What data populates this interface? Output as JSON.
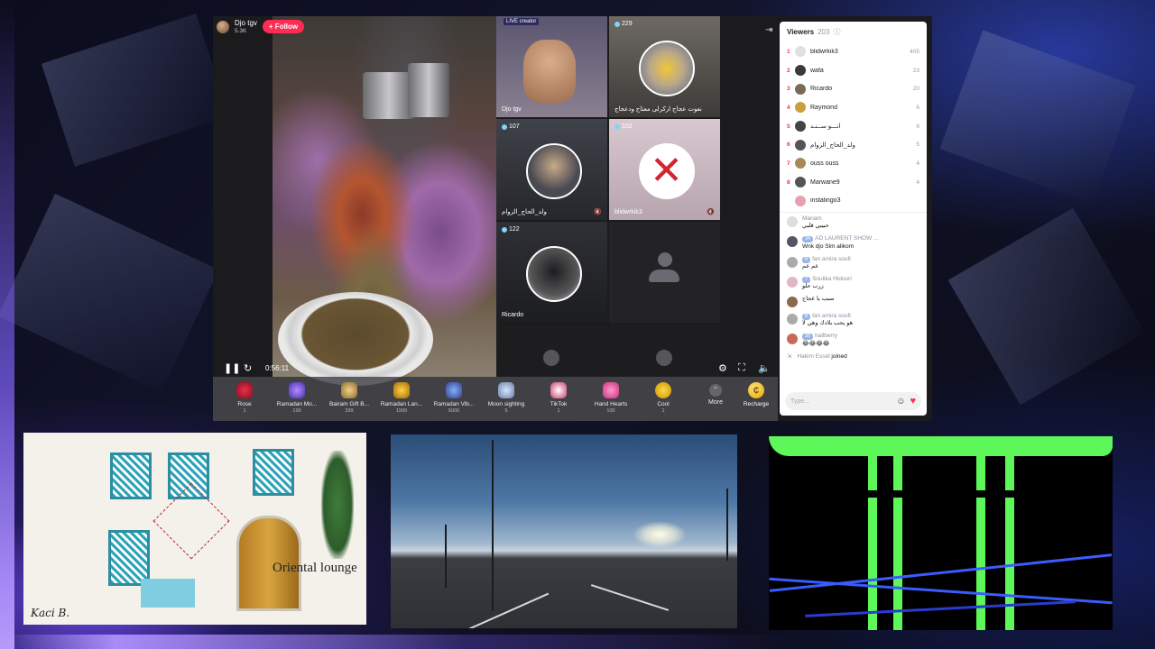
{
  "stream": {
    "host_name": "Djo tgv",
    "host_sub": "5.3K",
    "follow_label": "+ Follow",
    "time": "0:56:11",
    "colors": {
      "accent": "#fe2c55",
      "panel_bg": "#ffffff"
    }
  },
  "tiles": [
    {
      "count": "",
      "label": "Djo tgv",
      "banner": "LIVE creator"
    },
    {
      "count": "229",
      "label": "نعوت عجاج ارکرلی معتاج ودعجاج"
    },
    {
      "count": "107",
      "label": "ولد_الحاج_الزوام"
    },
    {
      "count": "102",
      "label": "blidwrkik3"
    },
    {
      "count": "122",
      "label": "Ricardo"
    },
    {
      "count": "",
      "label": ""
    }
  ],
  "gifts": [
    {
      "name": "Rose",
      "price": "1"
    },
    {
      "name": "Ramadan Mo...",
      "price": "199"
    },
    {
      "name": "Bairam Gift B...",
      "price": "399"
    },
    {
      "name": "Ramadan Lan...",
      "price": "1999"
    },
    {
      "name": "Ramadan Vib...",
      "price": "5000"
    },
    {
      "name": "Moon sighting",
      "price": "5"
    },
    {
      "name": "TikTok",
      "price": "1"
    },
    {
      "name": "Hand Hearts",
      "price": "100"
    },
    {
      "name": "Cool",
      "price": "1"
    }
  ],
  "gifts_more": "More",
  "recharge": "Recharge",
  "viewers": {
    "title": "Viewers",
    "count": "203",
    "list": [
      {
        "rank": "1",
        "name": "blidwrkik3",
        "score": "405",
        "color": "#e0e0e0"
      },
      {
        "rank": "2",
        "name": "wafa",
        "score": "23",
        "color": "#3a3a3a"
      },
      {
        "rank": "3",
        "name": "Ricardo",
        "score": "20",
        "color": "#7a6a5a"
      },
      {
        "rank": "4",
        "name": "Raymond",
        "score": "6",
        "color": "#c8a040"
      },
      {
        "rank": "5",
        "name": "انـــو ســنـد",
        "score": "6",
        "color": "#444"
      },
      {
        "rank": "6",
        "name": "ولد_الحاج_الزوام",
        "score": "5",
        "color": "#555"
      },
      {
        "rank": "7",
        "name": "ouss ouss",
        "score": "4",
        "color": "#a88a5a"
      },
      {
        "rank": "8",
        "name": "Marwane9",
        "score": "4",
        "color": "#555"
      },
      {
        "rank": "",
        "name": "instalingo3",
        "score": "",
        "color": "#e8a0b0"
      }
    ]
  },
  "chat": [
    {
      "name": "Mariam",
      "msg": "حبيبي قلبي",
      "badges": []
    },
    {
      "name": "AD LAURENT SHOW ...",
      "msg": "Wnk djo Slm alikom",
      "badges": [
        "34",
        ""
      ]
    },
    {
      "name": "fan amira soufi",
      "msg": "عم عم",
      "badges": [
        "8",
        ""
      ]
    },
    {
      "name": "Soulika Hidouri",
      "msg": "زرب حلو",
      "badges": [
        "7"
      ]
    },
    {
      "name": "",
      "msg": "سبب يا عجاج",
      "badges": [
        "",
        ""
      ]
    },
    {
      "name": "fan amira soufi",
      "msg": "هو يحب بلادك وهي لا",
      "badges": [
        "8",
        ""
      ]
    },
    {
      "name": "hallberry",
      "msg": "😂😂😂😂",
      "badges": [
        "35"
      ]
    }
  ],
  "joined": {
    "name": "Hakim Essid",
    "text": "joined"
  },
  "input_placeholder": "Type...",
  "thumbs": {
    "lounge_title": "Oriental lounge",
    "signature": "Kaci B."
  }
}
